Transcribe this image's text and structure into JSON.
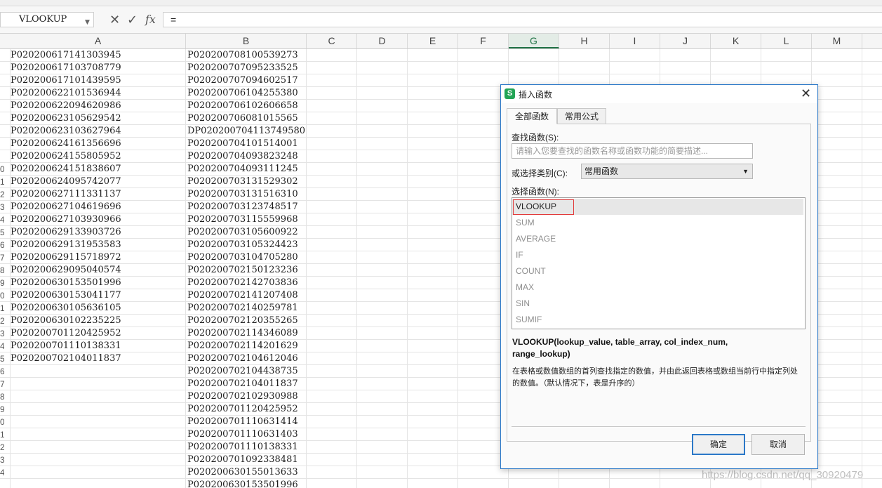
{
  "formula_bar": {
    "name_box": "VLOOKUP",
    "cancel_icon": "✕",
    "enter_icon": "✓",
    "fx_label": "fx",
    "formula_text": "="
  },
  "columns": [
    "A",
    "B",
    "C",
    "D",
    "E",
    "F",
    "G",
    "H",
    "I",
    "J",
    "K",
    "L",
    "M"
  ],
  "active_column": "G",
  "row_numbers": [
    "",
    "",
    "",
    "",
    "",
    "",
    "",
    "",
    "",
    "0",
    "1",
    "2",
    "3",
    "4",
    "5",
    "6",
    "7",
    "8",
    "9",
    "0",
    "1",
    "2",
    "3",
    "4",
    "5",
    "6",
    "7",
    "8",
    "9",
    "0",
    "1",
    "2",
    "3",
    "4",
    ""
  ],
  "column_a": [
    "P020200617141303945",
    "P020200617103708779",
    "P020200617101439595",
    "P020200622101536944",
    "P020200622094620986",
    "P020200623105629542",
    "P020200623103627964",
    "P020200624161356696",
    "P020200624155805952",
    "P020200624151838607",
    "P020200624095742077",
    "P020200627111331137",
    "P020200627104619696",
    "P020200627103930966",
    "P020200629133903726",
    "P020200629131953583",
    "P020200629115718972",
    "P020200629095040574",
    "P020200630153501996",
    "P020200630153041177",
    "P020200630105636105",
    "P020200630102235225",
    "P020200701120425952",
    "P020200701110138331",
    "P020200702104011837"
  ],
  "column_b": [
    "P020200708100539273",
    "P020200707095233525",
    "P020200707094602517",
    "P020200706104255380",
    "P020200706102606658",
    "P020200706081015565",
    "DP020200704113749580",
    "P020200704101514001",
    "P020200704093823248",
    "P020200704093111245",
    "P020200703131529302",
    "P020200703131516310",
    "P020200703123748517",
    "P020200703115559968",
    "P020200703105600922",
    "P020200703105324423",
    "P020200703104705280",
    "P020200702150123236",
    "P020200702142703836",
    "P020200702141207408",
    "P020200702140259781",
    "P020200702120355265",
    "P020200702114346089",
    "P020200702114201629",
    "P020200702104612046",
    "P020200702104438735",
    "P020200702104011837",
    "P020200702102930988",
    "P020200701120425952",
    "P020200701110631414",
    "P020200701110631403",
    "P020200701110138331",
    "P020200701092338481",
    "P020200630155013633",
    "P020200630153501996"
  ],
  "watermark": "https://blog.csdn.net/qq_30920479",
  "dialog": {
    "title": "插入函数",
    "app_icon": "S",
    "close_icon": "✕",
    "tabs": [
      "全部函数",
      "常用公式"
    ],
    "search_label": "查找函数(S):",
    "search_placeholder": "请输入您要查找的函数名称或函数功能的简要描述...",
    "category_label": "或选择类别(C):",
    "category_value": "常用函数",
    "list_label": "选择函数(N):",
    "functions": [
      "VLOOKUP",
      "SUM",
      "AVERAGE",
      "IF",
      "COUNT",
      "MAX",
      "SIN",
      "SUMIF"
    ],
    "selected_function": "VLOOKUP",
    "syntax": "VLOOKUP(lookup_value, table_array, col_index_num, range_lookup)",
    "description": "在表格或数值数组的首列查找指定的数值，并由此返回表格或数组当前行中指定列处的数值。（默认情况下，表是升序的）",
    "ok_label": "确定",
    "cancel_label": "取消"
  }
}
